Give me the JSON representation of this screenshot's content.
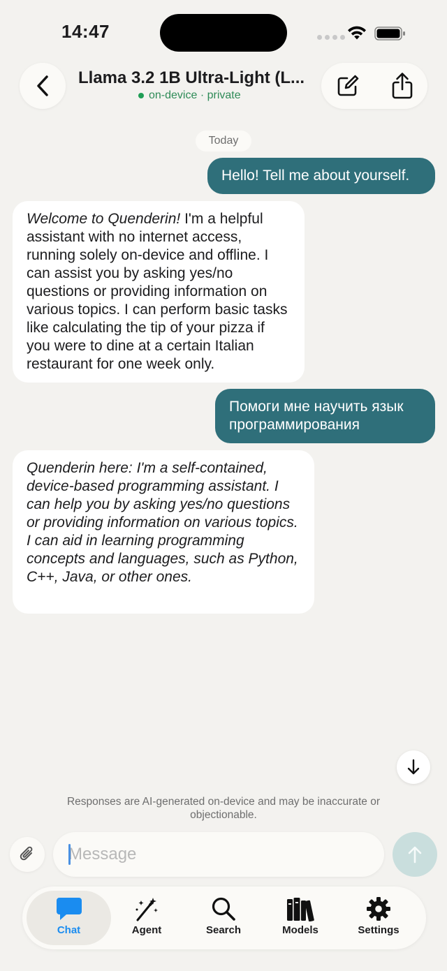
{
  "status_bar": {
    "time": "14:47"
  },
  "header": {
    "title": "Llama 3.2 1B Ultra-Light (L...",
    "subtitle": "on-device · private"
  },
  "date_separator": "Today",
  "messages": [
    {
      "role": "user",
      "text": "Hello! Tell me about yourself."
    },
    {
      "role": "assistant",
      "italic_prefix": "Welcome to Quenderin!",
      "text": " I'm a helpful assistant with no internet access, running solely on-device and offline. I can assist you by asking yes/no questions or providing information on various topics. I can perform basic tasks like calculating the tip of your pizza if you were to dine at a certain Italian restaurant for one week only."
    },
    {
      "role": "user",
      "text": "Помоги мне научить язык программирования"
    },
    {
      "role": "assistant",
      "text": "Quenderin here: I'm a self-contained, device-based programming assistant. I can help you by asking yes/no questions or providing information on various topics. I can aid in learning programming concepts and languages, such as Python, C++, Java, or other ones."
    }
  ],
  "disclaimer": "Responses are AI-generated on-device and may be inaccurate or objectionable.",
  "composer": {
    "placeholder": "Message",
    "value": ""
  },
  "tabs": [
    {
      "label": "Chat",
      "icon": "chat-bubble-icon",
      "active": true
    },
    {
      "label": "Agent",
      "icon": "magic-wand-icon",
      "active": false
    },
    {
      "label": "Search",
      "icon": "search-icon",
      "active": false
    },
    {
      "label": "Models",
      "icon": "books-icon",
      "active": false
    },
    {
      "label": "Settings",
      "icon": "gear-icon",
      "active": false
    }
  ],
  "colors": {
    "background": "#f3f2ef",
    "user_bubble": "#2f6f7a",
    "online_green": "#1f9d55",
    "active_tab": "#1a8cf0",
    "send_disabled": "#c9dedd"
  }
}
